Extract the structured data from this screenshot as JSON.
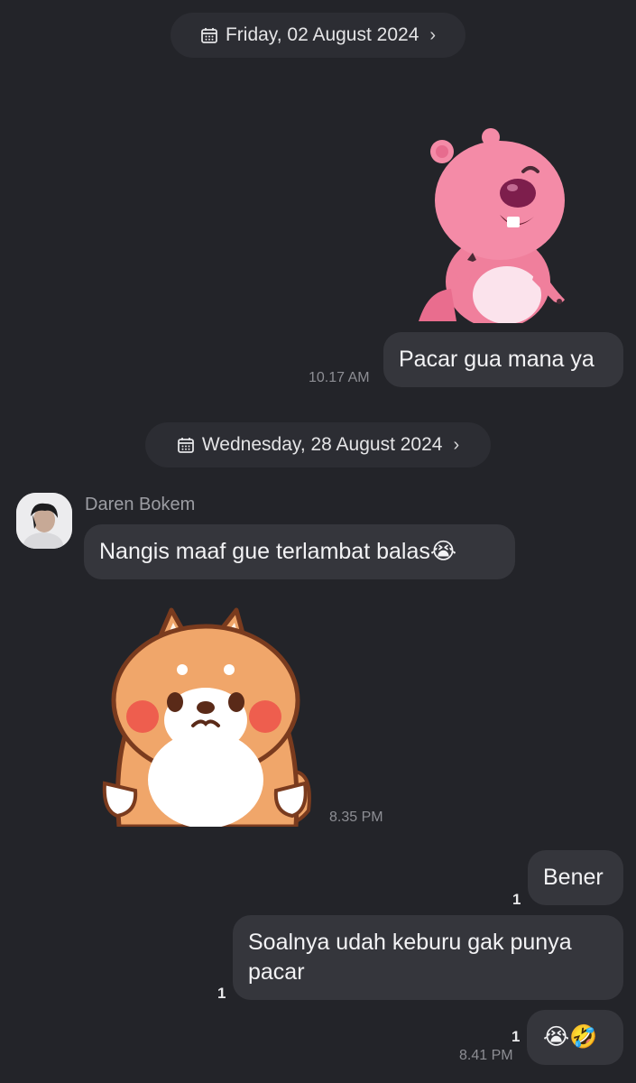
{
  "dates": [
    {
      "label": "Friday, 02 August 2024",
      "chevron": "›",
      "icon": "calendar-icon"
    },
    {
      "label": "Wednesday, 28 August 2024",
      "chevron": "›",
      "icon": "calendar-icon"
    }
  ],
  "messages": {
    "m1": {
      "text": "Pacar gua mana ya",
      "time": "10.17 AM"
    },
    "sender": {
      "name": "Daren Bokem"
    },
    "m2": {
      "text": "Nangis maaf gue terlambat balas😭"
    },
    "m3": {
      "time": "8.35 PM"
    },
    "m4": {
      "text": "Bener",
      "read_count": "1"
    },
    "m5": {
      "text": "Soalnya udah keburu gak punya pacar",
      "read_count": "1"
    },
    "m6": {
      "text": "😭🤣",
      "read_count": "1",
      "time": "8.41 PM"
    }
  },
  "stickers": {
    "pink_beaver": "pink-beaver-sticker",
    "shiba_dog": "shiba-dog-sticker"
  },
  "colors": {
    "background": "#232429",
    "bubble": "#35363c",
    "date_pill": "#2c2d33",
    "timestamp": "#8d8e94"
  }
}
